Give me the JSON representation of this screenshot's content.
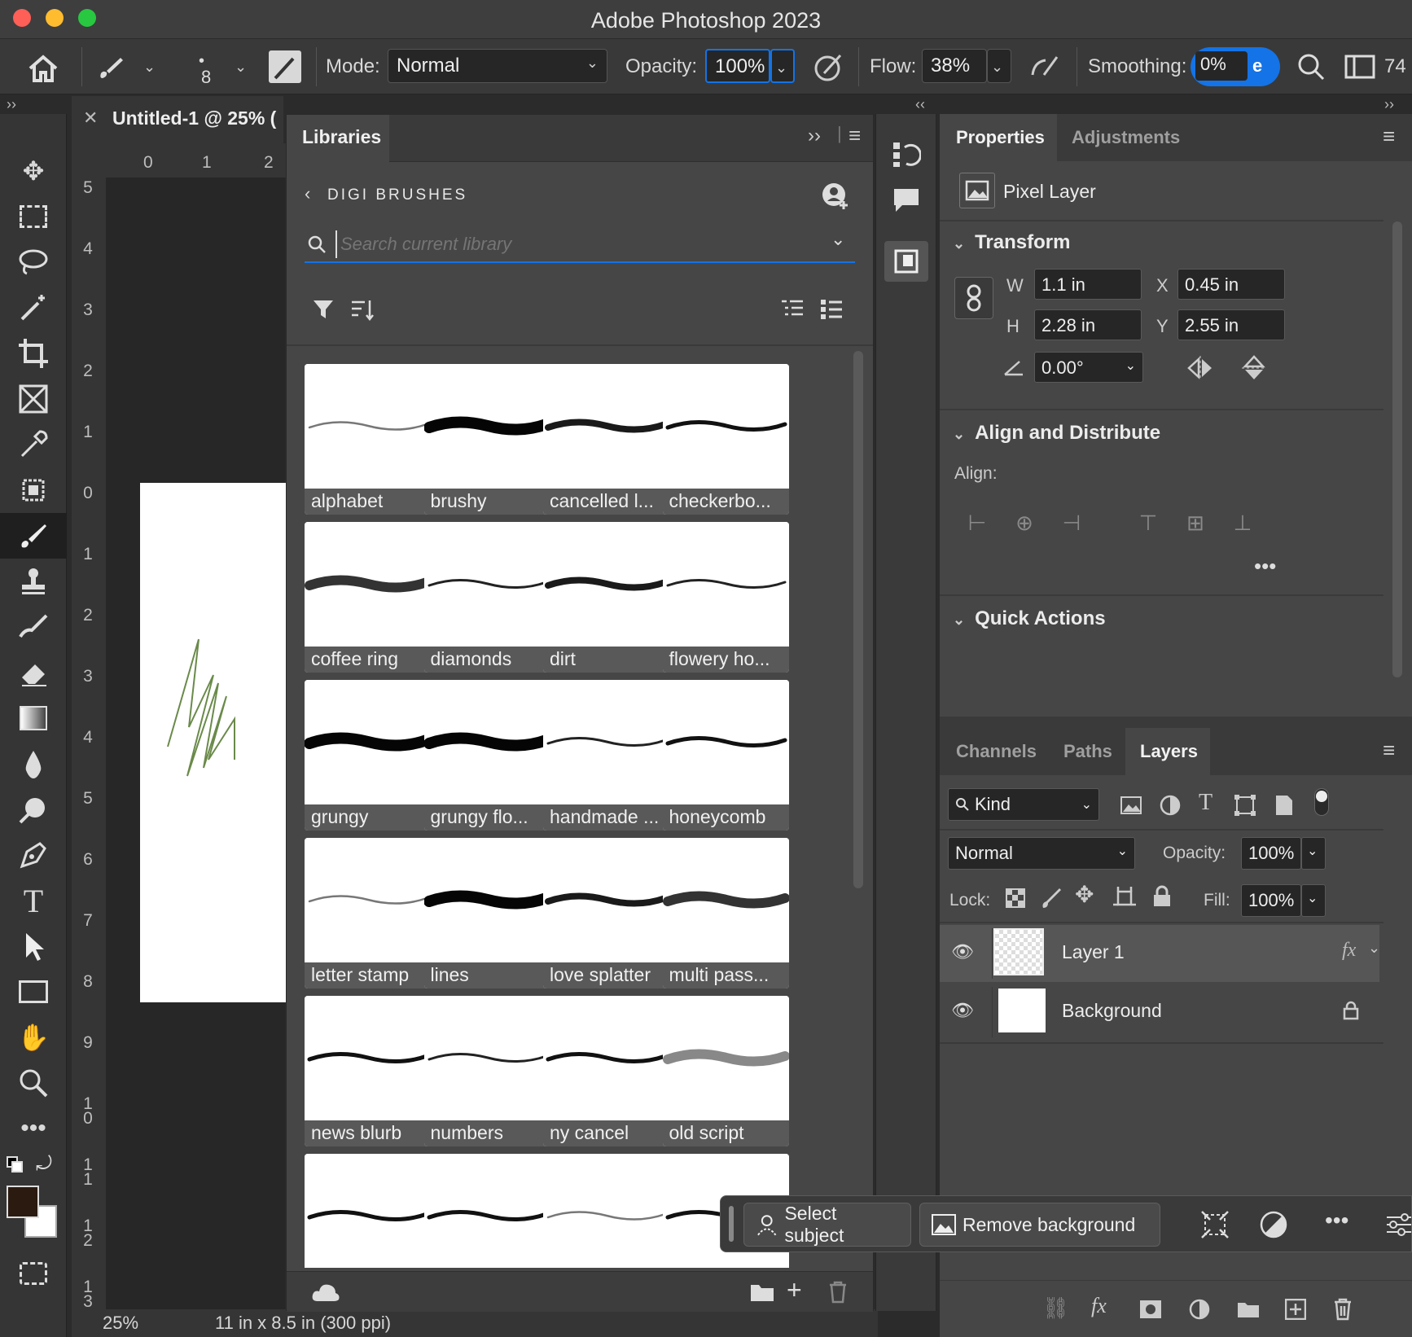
{
  "app": {
    "title": "Adobe Photoshop 2023"
  },
  "options": {
    "brush_size": "8",
    "mode_label": "Mode:",
    "mode_value": "Normal",
    "opacity_label": "Opacity:",
    "opacity_value": "100%",
    "flow_label": "Flow:",
    "flow_value": "38%",
    "smoothing_label": "Smoothing:",
    "smoothing_value": "0%",
    "smoothing_extra": "e",
    "trailing_num": "74"
  },
  "document": {
    "tab_title": "Untitled-1 @ 25% (",
    "ruler_h": [
      "0",
      "1",
      "2"
    ],
    "ruler_v": [
      "5",
      "4",
      "3",
      "2",
      "1",
      "0",
      "1",
      "2",
      "3",
      "4",
      "5",
      "6",
      "7",
      "8",
      "9",
      "1 0",
      "1 1",
      "1 2",
      "1 3"
    ],
    "zoom": "25%",
    "doc_info": "11 in x 8.5 in (300 ppi)"
  },
  "libraries": {
    "tab_label": "Libraries",
    "library_name": "DIGI BRUSHES",
    "search_placeholder": "Search current library",
    "brushes": [
      {
        "label": "alphabet",
        "stroke": "thin-gray"
      },
      {
        "label": "brushy",
        "stroke": "thick"
      },
      {
        "label": "cancelled l...",
        "stroke": "medium-rough"
      },
      {
        "label": "checkerbo...",
        "stroke": "medium"
      },
      {
        "label": "coffee ring",
        "stroke": "textured"
      },
      {
        "label": "diamonds",
        "stroke": "thin"
      },
      {
        "label": "dirt",
        "stroke": "medium-rough"
      },
      {
        "label": "flowery ho...",
        "stroke": "thin"
      },
      {
        "label": "grungy",
        "stroke": "thick"
      },
      {
        "label": "grungy flo...",
        "stroke": "thick"
      },
      {
        "label": "handmade ...",
        "stroke": "thin"
      },
      {
        "label": "honeycomb",
        "stroke": "medium"
      },
      {
        "label": "letter stamp",
        "stroke": "thin-gray"
      },
      {
        "label": "lines",
        "stroke": "thick"
      },
      {
        "label": "love splatter",
        "stroke": "medium-rough"
      },
      {
        "label": "multi pass...",
        "stroke": "textured"
      },
      {
        "label": "news blurb",
        "stroke": "medium"
      },
      {
        "label": "numbers",
        "stroke": "thin"
      },
      {
        "label": "ny cancel",
        "stroke": "medium"
      },
      {
        "label": "old script",
        "stroke": "soft-gray"
      },
      {
        "label": "",
        "stroke": "medium"
      },
      {
        "label": "",
        "stroke": "medium"
      },
      {
        "label": "",
        "stroke": "thin-gray"
      },
      {
        "label": "",
        "stroke": "medium"
      }
    ]
  },
  "properties": {
    "tabs": [
      "Properties",
      "Adjustments"
    ],
    "layer_type": "Pixel Layer",
    "transform_title": "Transform",
    "w_label": "W",
    "w_value": "1.1 in",
    "h_label": "H",
    "h_value": "2.28 in",
    "x_label": "X",
    "x_value": "0.45 in",
    "y_label": "Y",
    "y_value": "2.55 in",
    "angle_value": "0.00°",
    "align_title": "Align and Distribute",
    "align_label": "Align:",
    "quick_actions_title": "Quick Actions"
  },
  "layers_panel": {
    "tabs": [
      "Channels",
      "Paths",
      "Layers"
    ],
    "filter_kind": "Kind",
    "blend_mode": "Normal",
    "opacity_label": "Opacity:",
    "opacity_value": "100%",
    "lock_label": "Lock:",
    "fill_label": "Fill:",
    "fill_value": "100%",
    "layers": [
      {
        "name": "Layer 1",
        "fx": "fx"
      },
      {
        "name": "Background"
      }
    ]
  },
  "contextual_bar": {
    "select_subject": "Select subject",
    "remove_background": "Remove background"
  },
  "colors": {
    "foreground": "#2a1a10",
    "background": "#ffffff",
    "accent_blue": "#1473e6",
    "stroke_green": "#6a8a4a"
  }
}
